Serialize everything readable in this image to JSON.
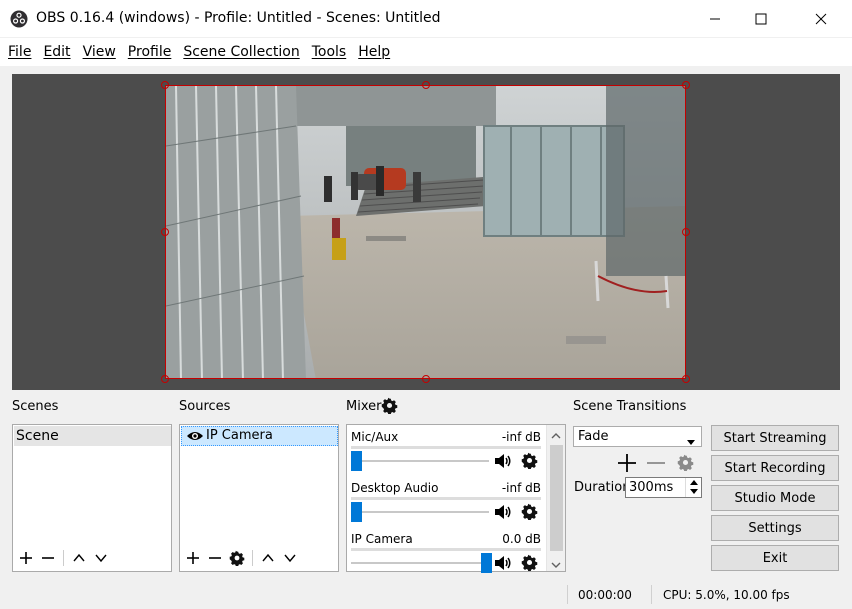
{
  "window": {
    "title": "OBS 0.16.4 (windows) - Profile: Untitled - Scenes: Untitled"
  },
  "menu": [
    "File",
    "Edit",
    "View",
    "Profile",
    "Scene Collection",
    "Tools",
    "Help"
  ],
  "scenes": {
    "label": "Scenes",
    "items": [
      "Scene"
    ]
  },
  "sources": {
    "label": "Sources",
    "items": [
      "IP Camera"
    ]
  },
  "mixer": {
    "label": "Mixer",
    "channels": [
      {
        "name": "Mic/Aux",
        "db": "-inf dB",
        "volume": 0.0
      },
      {
        "name": "Desktop Audio",
        "db": "-inf dB",
        "volume": 0.0
      },
      {
        "name": "IP Camera",
        "db": "0.0 dB",
        "volume": 1.0
      }
    ]
  },
  "transitions": {
    "label": "Scene Transitions",
    "selected": "Fade",
    "duration_label": "Duration",
    "duration_value": "300ms"
  },
  "controls": {
    "start_streaming": "Start Streaming",
    "start_recording": "Start Recording",
    "studio_mode": "Studio Mode",
    "settings": "Settings",
    "exit": "Exit"
  },
  "status": {
    "time": "00:00:00",
    "cpu": "CPU: 5.0%, 10.00 fps"
  },
  "colors": {
    "accent": "#0078d7",
    "selection_border": "#c40000",
    "preview_bg": "#4c4c4c"
  }
}
